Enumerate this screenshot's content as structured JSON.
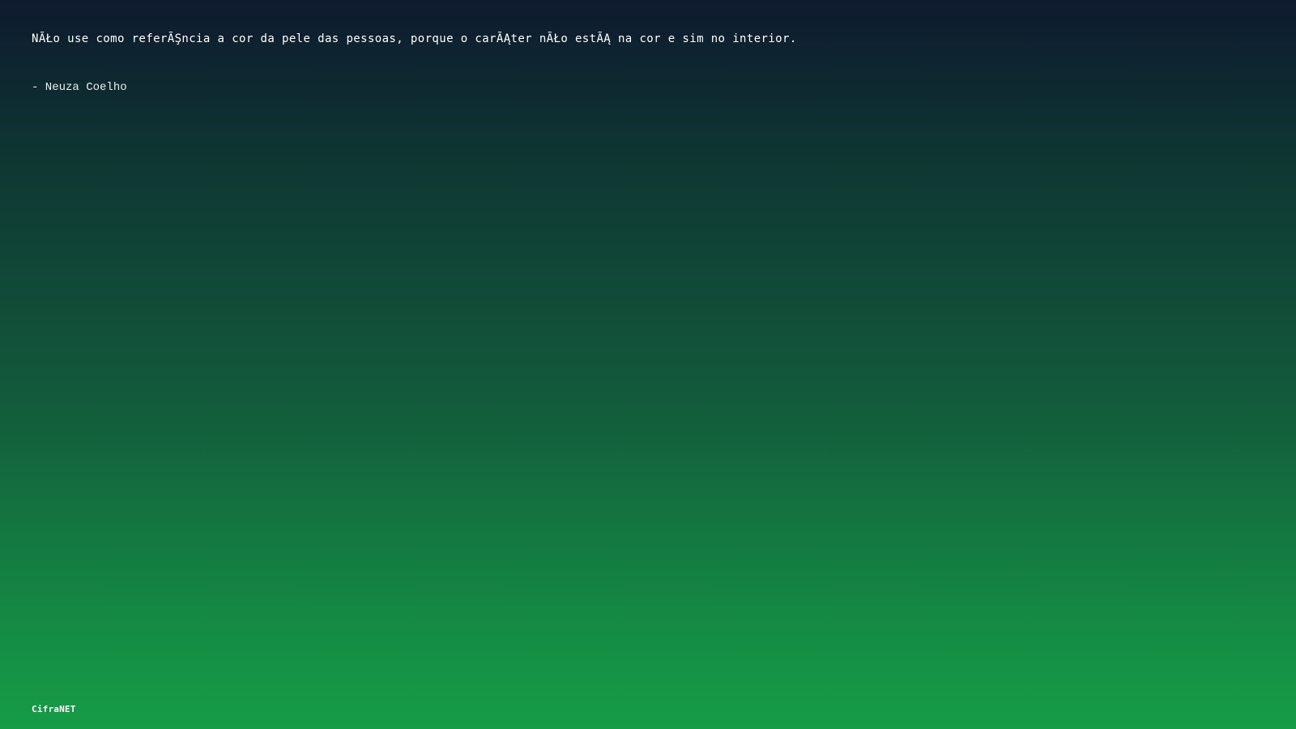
{
  "quote": {
    "text": "NÃŁo use como referÃŞncia a cor da pele das pessoas, porque o carÃĄter nÃŁo estÃĄ na cor e sim no interior.",
    "author": "- Neuza Coelho"
  },
  "footer": {
    "brand": "CifraNET"
  },
  "colors": {
    "background_top": "#0e1a2e",
    "background_bottom": "#169c47",
    "text": "#ffffff"
  }
}
